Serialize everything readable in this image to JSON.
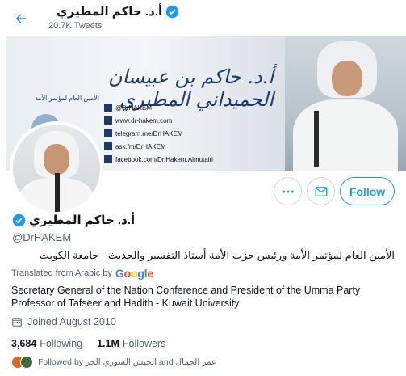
{
  "header": {
    "name": "أ.د. حاكم المطيري",
    "tweets_count": "20.7K Tweets"
  },
  "banner": {
    "title": "أ.د. حاكم بن عبيسان الحميداني المطيري",
    "subtitle": "الأمين العام لمؤتمر الأمة",
    "links": [
      "@DrHAKEM",
      "www.dr-hakem.com",
      "telegram.me/DrHAKEM",
      "ask.fm/DrHAKEM",
      "facebook.com/Dr.Hakem.Almutairi"
    ]
  },
  "actions": {
    "follow_label": "Follow"
  },
  "profile": {
    "name": "أ.د. حاكم المطيري",
    "handle": "@DrHAKEM",
    "bio_arabic": "الأمين العام لمؤتمر الأمة ورئيس حزب الأمة أستاذ التفسير والحديث - جامعة الكويت",
    "translated_label": "Translated from Arabic by",
    "google": [
      "G",
      "o",
      "o",
      "g",
      "l",
      "e"
    ],
    "bio_english": "Secretary General of the Nation Conference and President of the Umma Party Professor of Tafseer and Hadith - Kuwait University",
    "joined": "Joined August 2010",
    "following_count": "3,684",
    "following_label": "Following",
    "followers_count": "1.1M",
    "followers_label": "Followers",
    "followed_by": "Followed by الجيش السوري الحر and عمر الجمال"
  },
  "colors": {
    "accent": "#1d9bf0",
    "verified": "#1d9bf0",
    "muted": "#536471"
  },
  "icons": [
    "back-arrow-icon",
    "verified-badge-icon",
    "more-icon",
    "message-icon",
    "calendar-icon"
  ]
}
